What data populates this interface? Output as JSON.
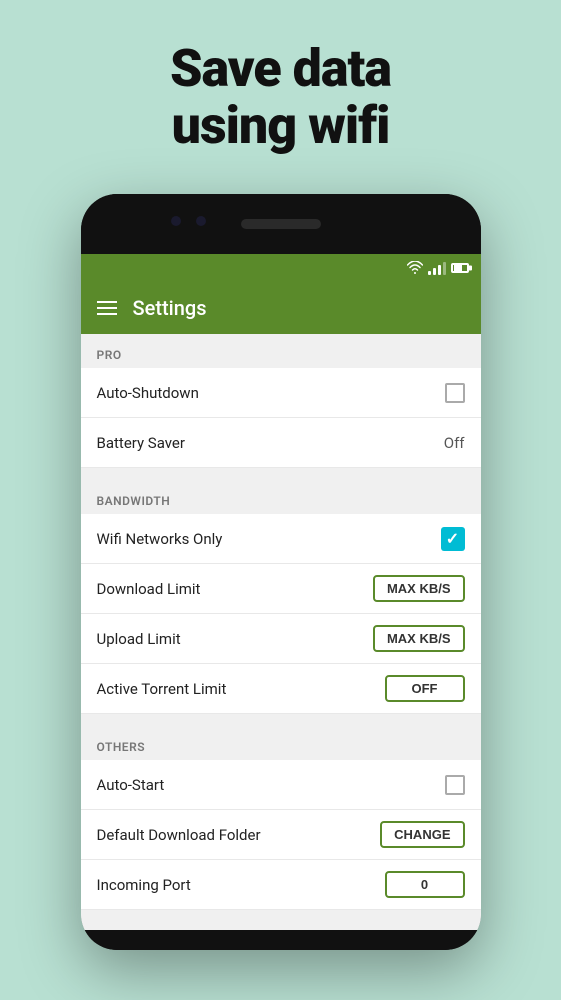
{
  "hero": {
    "line1": "Save data",
    "line2": "using wifi"
  },
  "app_bar": {
    "title": "Settings",
    "hamburger_label": "menu"
  },
  "sections": [
    {
      "header": "PRO",
      "items": [
        {
          "label": "Auto-Shutdown",
          "control": "checkbox",
          "value": false
        },
        {
          "label": "Battery Saver",
          "control": "text",
          "value": "Off"
        }
      ]
    },
    {
      "header": "BANDWIDTH",
      "items": [
        {
          "label": "Wifi Networks Only",
          "control": "checkbox-checked",
          "value": true
        },
        {
          "label": "Download Limit",
          "control": "button",
          "value": "MAX KB/S"
        },
        {
          "label": "Upload Limit",
          "control": "button",
          "value": "MAX KB/S"
        },
        {
          "label": "Active Torrent Limit",
          "control": "button",
          "value": "OFF"
        }
      ]
    },
    {
      "header": "OTHERS",
      "items": [
        {
          "label": "Auto-Start",
          "control": "checkbox",
          "value": false
        },
        {
          "label": "Default Download Folder",
          "control": "button",
          "value": "CHANGE"
        },
        {
          "label": "Incoming Port",
          "control": "button",
          "value": "0"
        }
      ]
    }
  ],
  "status": {
    "wifi": "▲",
    "signal": "▲",
    "battery": "▮"
  }
}
